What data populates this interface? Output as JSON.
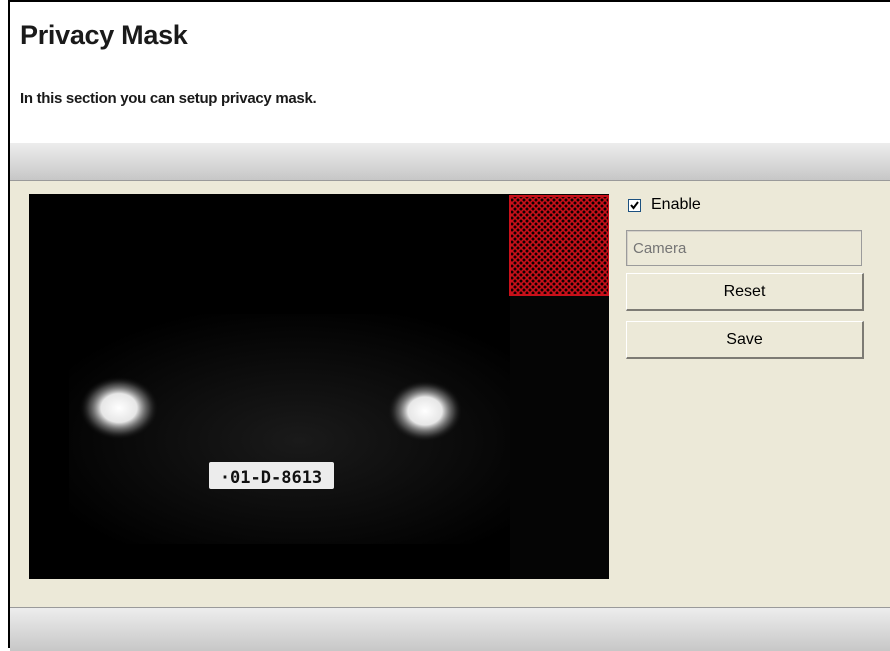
{
  "page": {
    "title": "Privacy Mask",
    "description": "In this section you can setup privacy mask."
  },
  "camera": {
    "plate_text": "·01-D-8613",
    "mask_color": "#c8101a"
  },
  "controls": {
    "enable_label": "Enable",
    "enable_checked": true,
    "camera_placeholder": "Camera",
    "reset_label": "Reset",
    "save_label": "Save"
  }
}
